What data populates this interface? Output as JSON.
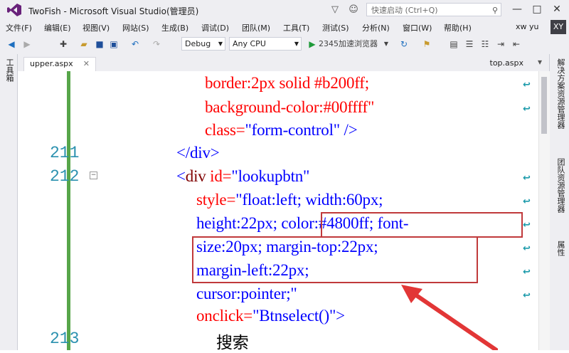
{
  "window": {
    "title": "TwoFish - Microsoft Visual Studio(管理员)",
    "quick_launch_placeholder": "快速启动 (Ctrl+Q)",
    "user": "xw yu",
    "avatar": "XY"
  },
  "menu": [
    "文件(F)",
    "编辑(E)",
    "视图(V)",
    "网站(S)",
    "生成(B)",
    "调试(D)",
    "团队(M)",
    "工具(T)",
    "测试(S)",
    "分析(N)",
    "窗口(W)",
    "帮助(H)"
  ],
  "toolbar": {
    "config": "Debug",
    "platform": "Any CPU",
    "run_target": "2345加速浏览器"
  },
  "side": {
    "left": "工具箱",
    "right": [
      "解决方案资源管理器",
      "团队资源管理器",
      "属性"
    ]
  },
  "tabs": {
    "active": "upper.aspx",
    "other": "top.aspx"
  },
  "lines": {
    "n211": "211",
    "n212": "212",
    "n213": "213"
  },
  "code": {
    "l1_attr": "border:2px solid #b200ff;",
    "l2_attr": "background-color:#00ffff\"",
    "l3_a": "class=",
    "l3_b": "\"form-control\"",
    "l3_c": " />",
    "l4": "</div>",
    "l5_open": "<",
    "l5_tag": "div",
    "l5_attr": " id=",
    "l5_val": "\"lookupbtn\"",
    "l6_attr": "style=",
    "l6_val": "\"float:left; width:60px;",
    "l7": "height:22px; color:#4800ff; font-",
    "l8": "size:20px; margin-top:22px;",
    "l9": "margin-left:22px;",
    "l10": "cursor:pointer;\"",
    "l11_attr": "onclick=",
    "l11_val": "\"Btnselect()\"",
    "l11_end": ">",
    "l12": "搜索"
  },
  "colors": {
    "highlight_box": "#c0393b",
    "change_bar": "#57a64a",
    "line_numbers": "#2b91af"
  }
}
